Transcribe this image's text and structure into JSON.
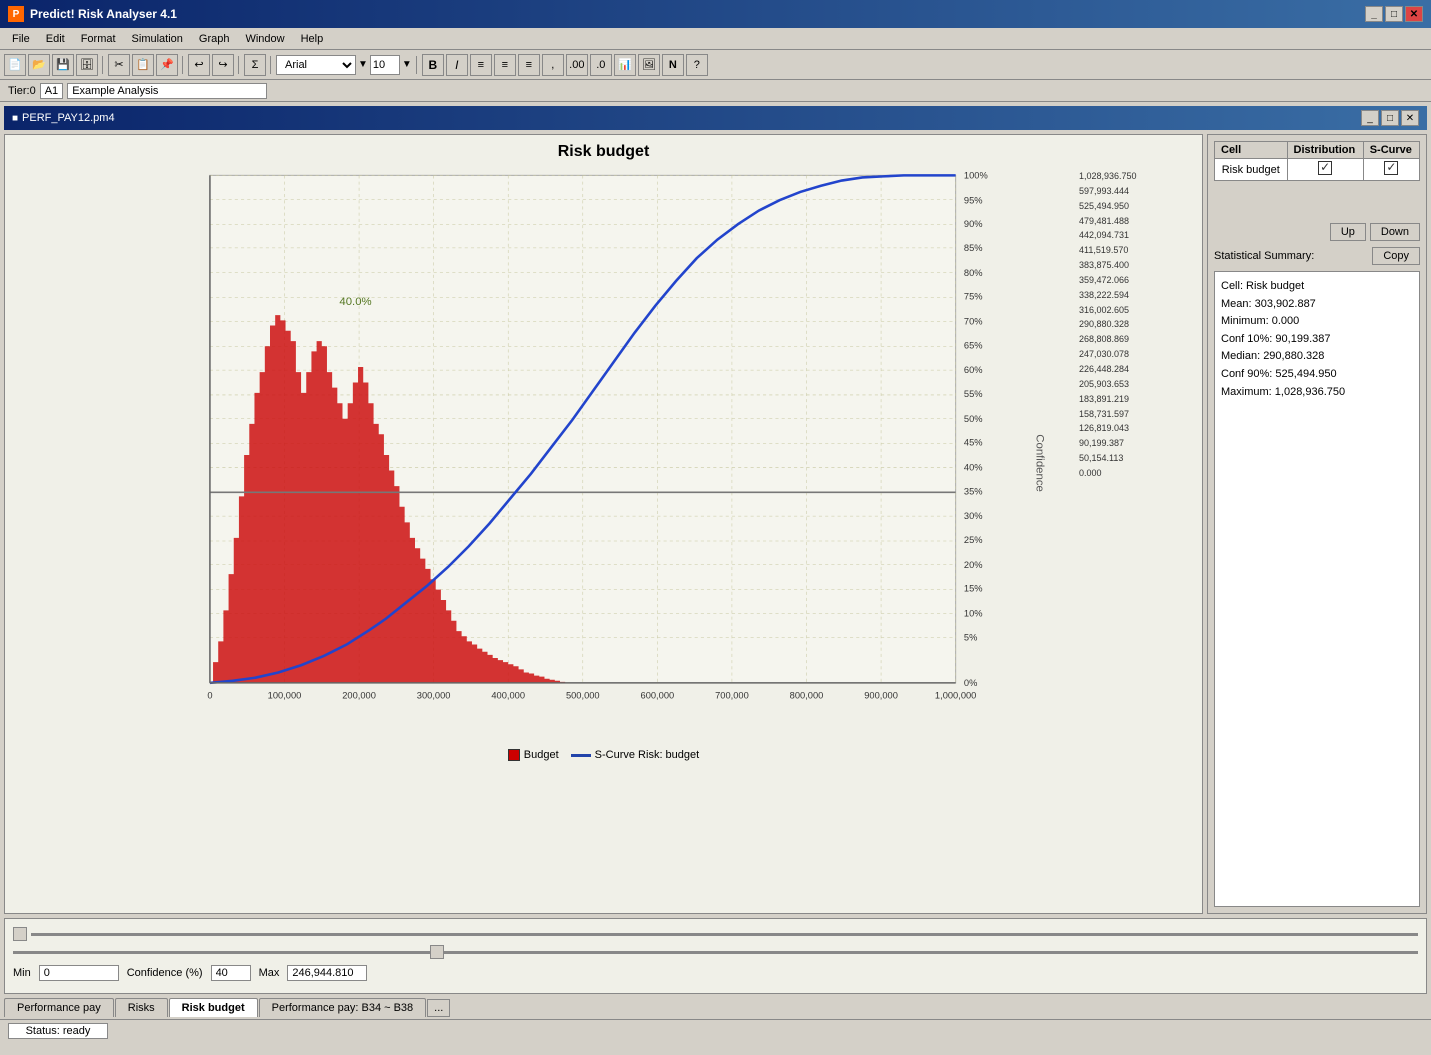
{
  "app": {
    "title": "Predict! Risk Analyser 4.1",
    "title_controls": [
      "_",
      "□",
      "✕"
    ]
  },
  "menu": {
    "items": [
      "File",
      "Edit",
      "Format",
      "Simulation",
      "Graph",
      "Window",
      "Help"
    ]
  },
  "toolbar": {
    "font": "Arial",
    "size": "10",
    "bold": "B",
    "italic": "I"
  },
  "info_bar": {
    "tier": "Tier:0",
    "cell": "A1",
    "analysis": "Example Analysis"
  },
  "doc": {
    "title": "PERF_PAY12.pm4",
    "controls": [
      "_",
      "□",
      "✕"
    ]
  },
  "chart": {
    "title": "Risk budget",
    "peak_label": "40.0%",
    "x_labels": [
      "0",
      "100,000",
      "200,000",
      "300,000",
      "400,000",
      "500,000",
      "600,000",
      "700,000",
      "800,000",
      "900,000",
      "1,000,000"
    ],
    "confidence_label": "Confidence",
    "percentiles": [
      {
        "pct": "100%",
        "value": "1,028,936.750"
      },
      {
        "pct": "95%",
        "value": "597,993.444"
      },
      {
        "pct": "90%",
        "value": "525,494.950"
      },
      {
        "pct": "85%",
        "value": "479,481.488"
      },
      {
        "pct": "80%",
        "value": "442,094.731"
      },
      {
        "pct": "75%",
        "value": "411,519.570"
      },
      {
        "pct": "70%",
        "value": "383,875.400"
      },
      {
        "pct": "65%",
        "value": "359,472.066"
      },
      {
        "pct": "60%",
        "value": "338,222.594"
      },
      {
        "pct": "55%",
        "value": "316,002.605"
      },
      {
        "pct": "50%",
        "value": "290,880.328"
      },
      {
        "pct": "45%",
        "value": "268,808.869"
      },
      {
        "pct": "40%",
        "value": "247,030.078"
      },
      {
        "pct": "35%",
        "value": "226,448.284"
      },
      {
        "pct": "30%",
        "value": "205,903.653"
      },
      {
        "pct": "25%",
        "value": "183,891.219"
      },
      {
        "pct": "20%",
        "value": "158,731.597"
      },
      {
        "pct": "15%",
        "value": "126,819.043"
      },
      {
        "pct": "10%",
        "value": "90,199.387"
      },
      {
        "pct": "5%",
        "value": "50,154.113"
      },
      {
        "pct": "0%",
        "value": "0.000"
      }
    ],
    "legend": {
      "budget_label": "Budget",
      "scurve_label": "S-Curve Risk: budget"
    }
  },
  "right_panel": {
    "table_headers": [
      "Cell",
      "Distribution",
      "S-Curve"
    ],
    "table_row": [
      "Risk budget",
      "checked",
      "checked"
    ],
    "btn_up": "Up",
    "btn_down": "Down",
    "stat_summary_label": "Statistical Summary:",
    "btn_copy": "Copy",
    "stats": {
      "cell": "Cell: Risk budget",
      "mean": "Mean: 303,902.887",
      "minimum": "Minimum: 0.000",
      "conf10": "Conf 10%: 90,199.387",
      "median": "Median: 290,880.328",
      "conf90": "Conf 90%: 525,494.950",
      "maximum": "Maximum: 1,028,936.750"
    }
  },
  "bottom_controls": {
    "min_label": "Min",
    "min_value": "0",
    "conf_label": "Confidence (%)",
    "conf_value": "40",
    "max_label": "Max",
    "max_value": "246,944.810"
  },
  "tabs": [
    {
      "label": "Performance pay",
      "active": false
    },
    {
      "label": "Risks",
      "active": false
    },
    {
      "label": "Risk budget",
      "active": true
    },
    {
      "label": "Performance pay: B34 ~ B38",
      "active": false
    }
  ],
  "tab_more": "...",
  "status": {
    "text": "Status: ready"
  }
}
